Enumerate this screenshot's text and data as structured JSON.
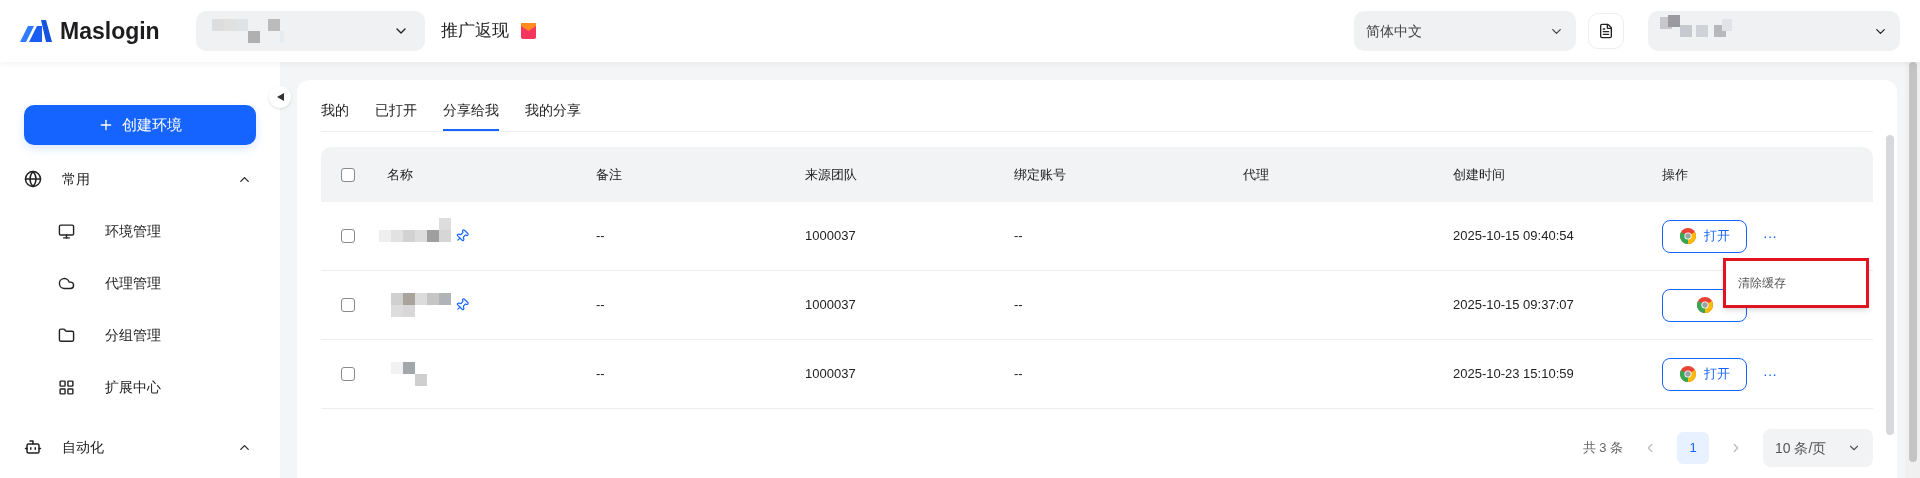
{
  "header": {
    "logo": "Maslogin",
    "promo": "推广返现",
    "language": "简体中文"
  },
  "sidebar": {
    "create_button": "创建环境",
    "sections": [
      {
        "label": "常用",
        "expanded": true,
        "items": [
          {
            "label": "环境管理"
          },
          {
            "label": "代理管理"
          },
          {
            "label": "分组管理"
          },
          {
            "label": "扩展中心"
          }
        ]
      },
      {
        "label": "自动化",
        "expanded": true
      }
    ]
  },
  "tabs": [
    {
      "label": "我的",
      "selected": false
    },
    {
      "label": "已打开",
      "selected": false
    },
    {
      "label": "分享给我",
      "selected": true
    },
    {
      "label": "我的分享",
      "selected": false
    }
  ],
  "table": {
    "select_all": {
      "checked": false
    },
    "columns": [
      "名称",
      "备注",
      "来源团队",
      "绑定账号",
      "代理",
      "创建时间",
      "操作"
    ],
    "rows": [
      {
        "checked": false,
        "pinned": true,
        "note": "--",
        "team": "1000037",
        "account": "--",
        "created": "2025-10-15 09:40:54",
        "open": "打开",
        "more": "···"
      },
      {
        "checked": false,
        "pinned": true,
        "note": "--",
        "team": "1000037",
        "account": "--",
        "created": "2025-10-15 09:37:07"
      },
      {
        "checked": false,
        "pinned": false,
        "note": "--",
        "team": "1000037",
        "account": "--",
        "created": "2025-10-23 15:10:59",
        "open": "打开",
        "more": "···"
      }
    ]
  },
  "popup_menu": {
    "items": [
      "清除缓存"
    ]
  },
  "pagination": {
    "total": "共 3 条",
    "pages": [
      {
        "label": "1",
        "selected": true
      }
    ],
    "page_size": "10 条/页"
  }
}
